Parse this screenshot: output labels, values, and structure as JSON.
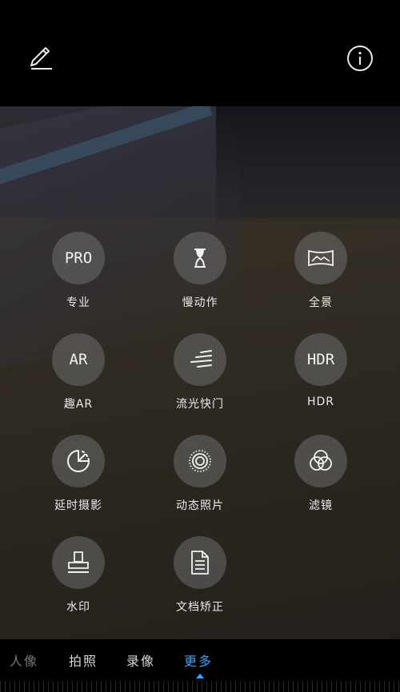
{
  "toolbar": {
    "edit_icon": "pencil-icon",
    "info_icon": "info-icon"
  },
  "modes": [
    {
      "id": "pro",
      "label": "专业",
      "icon_text": "PRO"
    },
    {
      "id": "slow-motion",
      "label": "慢动作",
      "icon": "hourglass-icon"
    },
    {
      "id": "panorama",
      "label": "全景",
      "icon": "panorama-icon"
    },
    {
      "id": "ar",
      "label": "趣AR",
      "icon_text": "AR"
    },
    {
      "id": "light-painting",
      "label": "流光快门",
      "icon": "light-trails-icon"
    },
    {
      "id": "hdr",
      "label": "HDR",
      "icon_text": "HDR"
    },
    {
      "id": "time-lapse",
      "label": "延时摄影",
      "icon": "time-lapse-icon"
    },
    {
      "id": "moving-picture",
      "label": "动态照片",
      "icon": "moving-picture-icon"
    },
    {
      "id": "filter",
      "label": "滤镜",
      "icon": "filter-icon"
    },
    {
      "id": "watermark",
      "label": "水印",
      "icon": "stamp-icon"
    },
    {
      "id": "document",
      "label": "文档矫正",
      "icon": "document-icon"
    }
  ],
  "tabs": [
    {
      "label": "人像",
      "state": "partial"
    },
    {
      "label": "拍照",
      "state": "normal"
    },
    {
      "label": "录像",
      "state": "normal"
    },
    {
      "label": "更多",
      "state": "active"
    }
  ],
  "colors": {
    "accent": "#2ea6ff",
    "icon_circle": "rgba(110,110,110,.55)",
    "label": "#eaeaea"
  }
}
